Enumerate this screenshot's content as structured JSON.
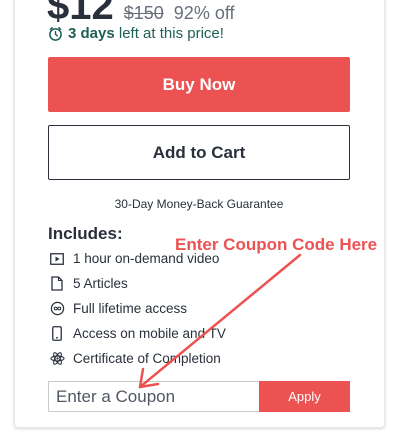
{
  "pricing": {
    "current_price": "$12",
    "original_price": "$150",
    "discount": "92% off"
  },
  "timer": {
    "days": "3 days",
    "suffix": " left at this price!"
  },
  "buttons": {
    "buy_now": "Buy Now",
    "add_to_cart": "Add to Cart"
  },
  "guarantee": "30-Day Money-Back Guarantee",
  "includes": {
    "title": "Includes:",
    "items": [
      {
        "icon": "video-icon",
        "label": "1 hour on-demand video"
      },
      {
        "icon": "file-icon",
        "label": "5 Articles"
      },
      {
        "icon": "infinity-icon",
        "label": "Full lifetime access"
      },
      {
        "icon": "mobile-icon",
        "label": "Access on mobile and TV"
      },
      {
        "icon": "certificate-icon",
        "label": "Certificate of Completion"
      }
    ]
  },
  "annotation": {
    "text": "Enter Coupon Code Here",
    "color": "#ec5252"
  },
  "coupon": {
    "placeholder": "Enter a Coupon",
    "apply_label": "Apply"
  },
  "colors": {
    "accent": "#ec5252",
    "timer_green": "#1e6055",
    "text_dark": "#29303b"
  }
}
